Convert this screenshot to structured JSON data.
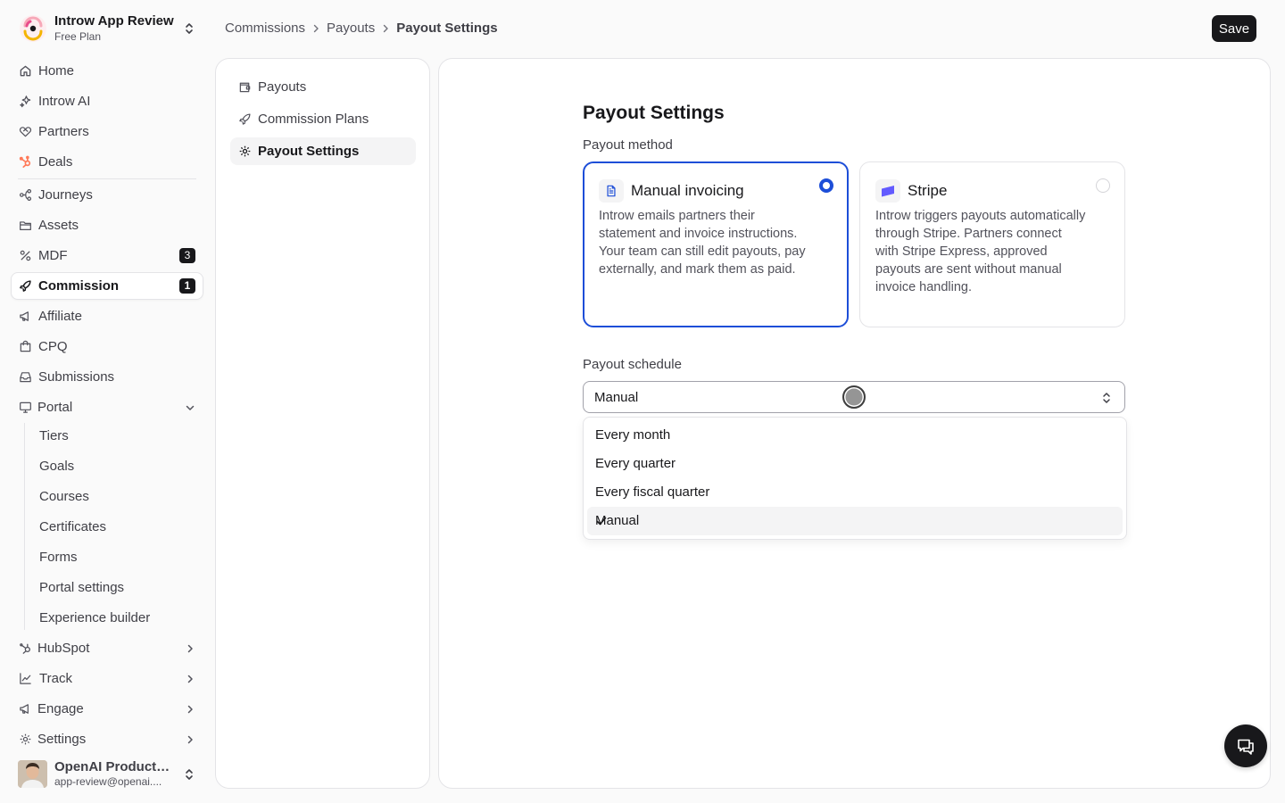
{
  "workspace": {
    "name": "Introw App Review",
    "plan": "Free Plan"
  },
  "sidebar": {
    "items": [
      {
        "label": "Home",
        "icon": "home-icon"
      },
      {
        "label": "Introw AI",
        "icon": "sparkles-icon"
      },
      {
        "label": "Partners",
        "icon": "handshake-icon"
      },
      {
        "label": "Deals",
        "icon": "hubspot-icon"
      },
      {
        "label": "Journeys",
        "icon": "workflow-icon"
      },
      {
        "label": "Assets",
        "icon": "folder-icon"
      },
      {
        "label": "MDF",
        "icon": "percent-icon",
        "badge": "3"
      },
      {
        "label": "Commission",
        "icon": "rocket-icon",
        "badge": "1",
        "active": true
      },
      {
        "label": "Affiliate",
        "icon": "megaphone-icon"
      },
      {
        "label": "CPQ",
        "icon": "shopping-bag-icon"
      },
      {
        "label": "Submissions",
        "icon": "inbox-icon"
      },
      {
        "label": "Portal",
        "icon": "monitor-icon",
        "expanded": true
      }
    ],
    "portal_sub": [
      "Tiers",
      "Goals",
      "Courses",
      "Certificates",
      "Forms",
      "Portal settings",
      "Experience builder"
    ],
    "bottom_items": [
      {
        "label": "HubSpot",
        "icon": "hubspot-icon"
      },
      {
        "label": "Track",
        "icon": "chart-line-icon"
      },
      {
        "label": "Engage",
        "icon": "megaphone-icon"
      },
      {
        "label": "Settings",
        "icon": "gear-icon"
      }
    ]
  },
  "user": {
    "name": "OpenAI Product ...",
    "email": "app-review@openai...."
  },
  "breadcrumb": {
    "items": [
      "Commissions",
      "Payouts"
    ],
    "current": "Payout Settings"
  },
  "header": {
    "save_label": "Save"
  },
  "subnav": {
    "items": [
      {
        "label": "Payouts",
        "icon": "wallet-icon"
      },
      {
        "label": "Commission Plans",
        "icon": "rocket-icon"
      },
      {
        "label": "Payout Settings",
        "icon": "gear-icon",
        "active": true
      }
    ]
  },
  "main": {
    "title": "Payout Settings",
    "method_label": "Payout method",
    "methods": [
      {
        "title": "Manual invoicing",
        "icon": "document-icon",
        "selected": true,
        "description": "Introw emails partners their statement and invoice instructions. Your team can still edit payouts, pay externally, and mark them as paid."
      },
      {
        "title": "Stripe",
        "icon": "stripe-icon",
        "selected": false,
        "description": "Introw triggers payouts automatically through Stripe. Partners connect with Stripe Express, approved payouts are sent without manual invoice handling."
      }
    ],
    "schedule_label": "Payout schedule",
    "schedule_value": "Manual",
    "schedule_options": [
      "Every month",
      "Every quarter",
      "Every fiscal quarter",
      "Manual"
    ],
    "schedule_selected": "Manual"
  },
  "colors": {
    "accent": "#1d4ed8",
    "dark": "#18181b",
    "hubspot": "#ff7a59",
    "stripe": "#635bff"
  }
}
